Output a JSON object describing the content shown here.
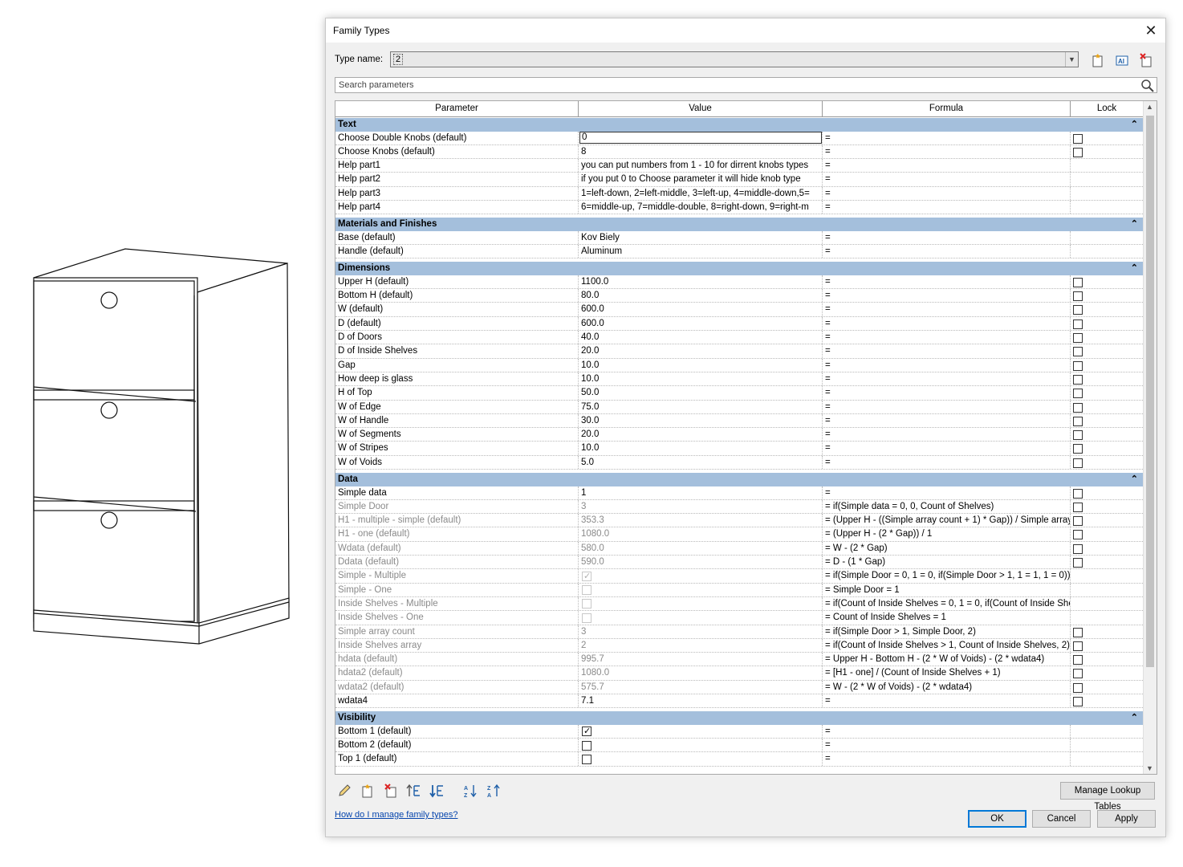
{
  "dialog": {
    "title": "Family Types",
    "type_name_label": "Type name:",
    "type_name_value": "2",
    "search_placeholder": "Search parameters"
  },
  "columns": [
    "Parameter",
    "Value",
    "Formula",
    "Lock"
  ],
  "groups": [
    {
      "name": "Text",
      "rows": [
        {
          "param": "Choose Double Knobs (default)",
          "value": "0",
          "formula": "=",
          "lock": "unchecked",
          "editing": true
        },
        {
          "param": "Choose Knobs (default)",
          "value": "8",
          "formula": "=",
          "lock": "unchecked"
        },
        {
          "param": "Help part1",
          "value": "you can put numbers from 1 - 10 for dirrent knobs types",
          "formula": "=",
          "lock": "none"
        },
        {
          "param": "Help part2",
          "value": "if you put 0 to Choose parameter it will hide knob type",
          "formula": "=",
          "lock": "none"
        },
        {
          "param": "Help part3",
          "value": "1=left-down, 2=left-middle, 3=left-up, 4=middle-down,5=",
          "formula": "=",
          "lock": "none"
        },
        {
          "param": "Help part4",
          "value": "6=middle-up, 7=middle-double, 8=right-down, 9=right-m",
          "formula": "=",
          "lock": "none"
        }
      ]
    },
    {
      "name": "Materials and Finishes",
      "rows": [
        {
          "param": "Base (default)",
          "value": "Kov Biely",
          "formula": "=",
          "lock": "none"
        },
        {
          "param": "Handle (default)",
          "value": "Aluminum",
          "formula": "=",
          "lock": "none"
        }
      ]
    },
    {
      "name": "Dimensions",
      "rows": [
        {
          "param": "Upper H (default)",
          "value": "1100.0",
          "formula": "=",
          "lock": "unchecked"
        },
        {
          "param": "Bottom H (default)",
          "value": "80.0",
          "formula": "=",
          "lock": "unchecked"
        },
        {
          "param": "W (default)",
          "value": "600.0",
          "formula": "=",
          "lock": "unchecked"
        },
        {
          "param": "D (default)",
          "value": "600.0",
          "formula": "=",
          "lock": "unchecked"
        },
        {
          "param": "D of Doors",
          "value": "40.0",
          "formula": "=",
          "lock": "unchecked"
        },
        {
          "param": "D of Inside Shelves",
          "value": "20.0",
          "formula": "=",
          "lock": "unchecked"
        },
        {
          "param": "Gap",
          "value": "10.0",
          "formula": "=",
          "lock": "unchecked"
        },
        {
          "param": "How deep is glass",
          "value": "10.0",
          "formula": "=",
          "lock": "unchecked"
        },
        {
          "param": "H of Top",
          "value": "50.0",
          "formula": "=",
          "lock": "unchecked"
        },
        {
          "param": "W of Edge",
          "value": "75.0",
          "formula": "=",
          "lock": "unchecked"
        },
        {
          "param": "W of Handle",
          "value": "30.0",
          "formula": "=",
          "lock": "unchecked"
        },
        {
          "param": "W of Segments",
          "value": "20.0",
          "formula": "=",
          "lock": "unchecked"
        },
        {
          "param": "W of Stripes",
          "value": "10.0",
          "formula": "=",
          "lock": "unchecked"
        },
        {
          "param": "W of Voids",
          "value": "5.0",
          "formula": "=",
          "lock": "unchecked"
        }
      ]
    },
    {
      "name": "Data",
      "rows": [
        {
          "param": "Simple data",
          "value": "1",
          "formula": "=",
          "lock": "unchecked"
        },
        {
          "param": "Simple Door",
          "value": "3",
          "formula": "= if(Simple data = 0, 0, Count of Shelves)",
          "lock": "unchecked",
          "grey": true
        },
        {
          "param": "H1 - multiple - simple (default)",
          "value": "353.3",
          "formula": "= (Upper H - ((Simple array count + 1) * Gap)) / Simple array",
          "lock": "unchecked",
          "grey": true
        },
        {
          "param": "H1 - one (default)",
          "value": "1080.0",
          "formula": "= (Upper H - (2 * Gap)) / 1",
          "lock": "unchecked",
          "grey": true
        },
        {
          "param": "Wdata (default)",
          "value": "580.0",
          "formula": "= W - (2 * Gap)",
          "lock": "unchecked",
          "grey": true
        },
        {
          "param": "Ddata (default)",
          "value": "590.0",
          "formula": "= D - (1 * Gap)",
          "lock": "unchecked",
          "grey": true
        },
        {
          "param": "Simple - Multiple",
          "value_check": "checked-dim",
          "formula": "= if(Simple Door = 0, 1 = 0, if(Simple Door > 1, 1 = 1, 1 = 0))",
          "lock": "none",
          "grey": true
        },
        {
          "param": "Simple - One",
          "value_check": "unchecked-dim",
          "formula": "= Simple Door = 1",
          "lock": "none",
          "grey": true
        },
        {
          "param": "Inside Shelves - Multiple",
          "value_check": "unchecked-dim",
          "formula": "= if(Count of Inside Shelves = 0, 1 = 0, if(Count of Inside Shel",
          "lock": "none",
          "grey": true
        },
        {
          "param": "Inside Shelves - One",
          "value_check": "unchecked-dim",
          "formula": "= Count of Inside Shelves = 1",
          "lock": "none",
          "grey": true
        },
        {
          "param": "Simple array count",
          "value": "3",
          "formula": "= if(Simple Door > 1, Simple Door, 2)",
          "lock": "unchecked",
          "grey": true
        },
        {
          "param": "Inside Shelves array",
          "value": "2",
          "formula": "= if(Count of Inside Shelves > 1, Count of Inside Shelves, 2)",
          "lock": "unchecked",
          "grey": true
        },
        {
          "param": "hdata (default)",
          "value": "995.7",
          "formula": "= Upper H - Bottom H - (2 * W of Voids) - (2 * wdata4)",
          "lock": "unchecked",
          "grey": true
        },
        {
          "param": "hdata2 (default)",
          "value": "1080.0",
          "formula": "= [H1 - one] / (Count of Inside Shelves + 1)",
          "lock": "unchecked",
          "grey": true
        },
        {
          "param": "wdata2 (default)",
          "value": "575.7",
          "formula": "= W - (2 * W of Voids) - (2 * wdata4)",
          "lock": "unchecked",
          "grey": true
        },
        {
          "param": "wdata4",
          "value": "7.1",
          "formula": "=",
          "lock": "unchecked"
        }
      ]
    },
    {
      "name": "Visibility",
      "rows": [
        {
          "param": "Bottom 1 (default)",
          "value_check": "checked",
          "formula": "=",
          "lock": "none"
        },
        {
          "param": "Bottom 2 (default)",
          "value_check": "unchecked",
          "formula": "=",
          "lock": "none"
        },
        {
          "param": "Top 1 (default)",
          "value_check": "unchecked",
          "formula": "=",
          "lock": "none"
        }
      ]
    }
  ],
  "buttons": {
    "manage_lookup": "Manage Lookup Tables",
    "ok": "OK",
    "cancel": "Cancel",
    "apply": "Apply"
  },
  "help_link": "How do I manage family types?",
  "icons": {
    "close": "close-icon",
    "new_type": "new-type-icon",
    "rename_type": "rename-type-icon",
    "delete_type": "delete-type-icon",
    "search": "search-icon",
    "edit_param": "pencil-icon",
    "new_param": "new-parameter-icon",
    "delete_param": "delete-parameter-icon",
    "move_up": "move-up-icon",
    "move_down": "move-down-icon",
    "sort_asc": "sort-ascending-icon",
    "sort_desc": "sort-descending-icon"
  },
  "colors": {
    "group_header": "#a4bfdc",
    "ok_border": "#0078d7",
    "link": "#0645ad"
  }
}
